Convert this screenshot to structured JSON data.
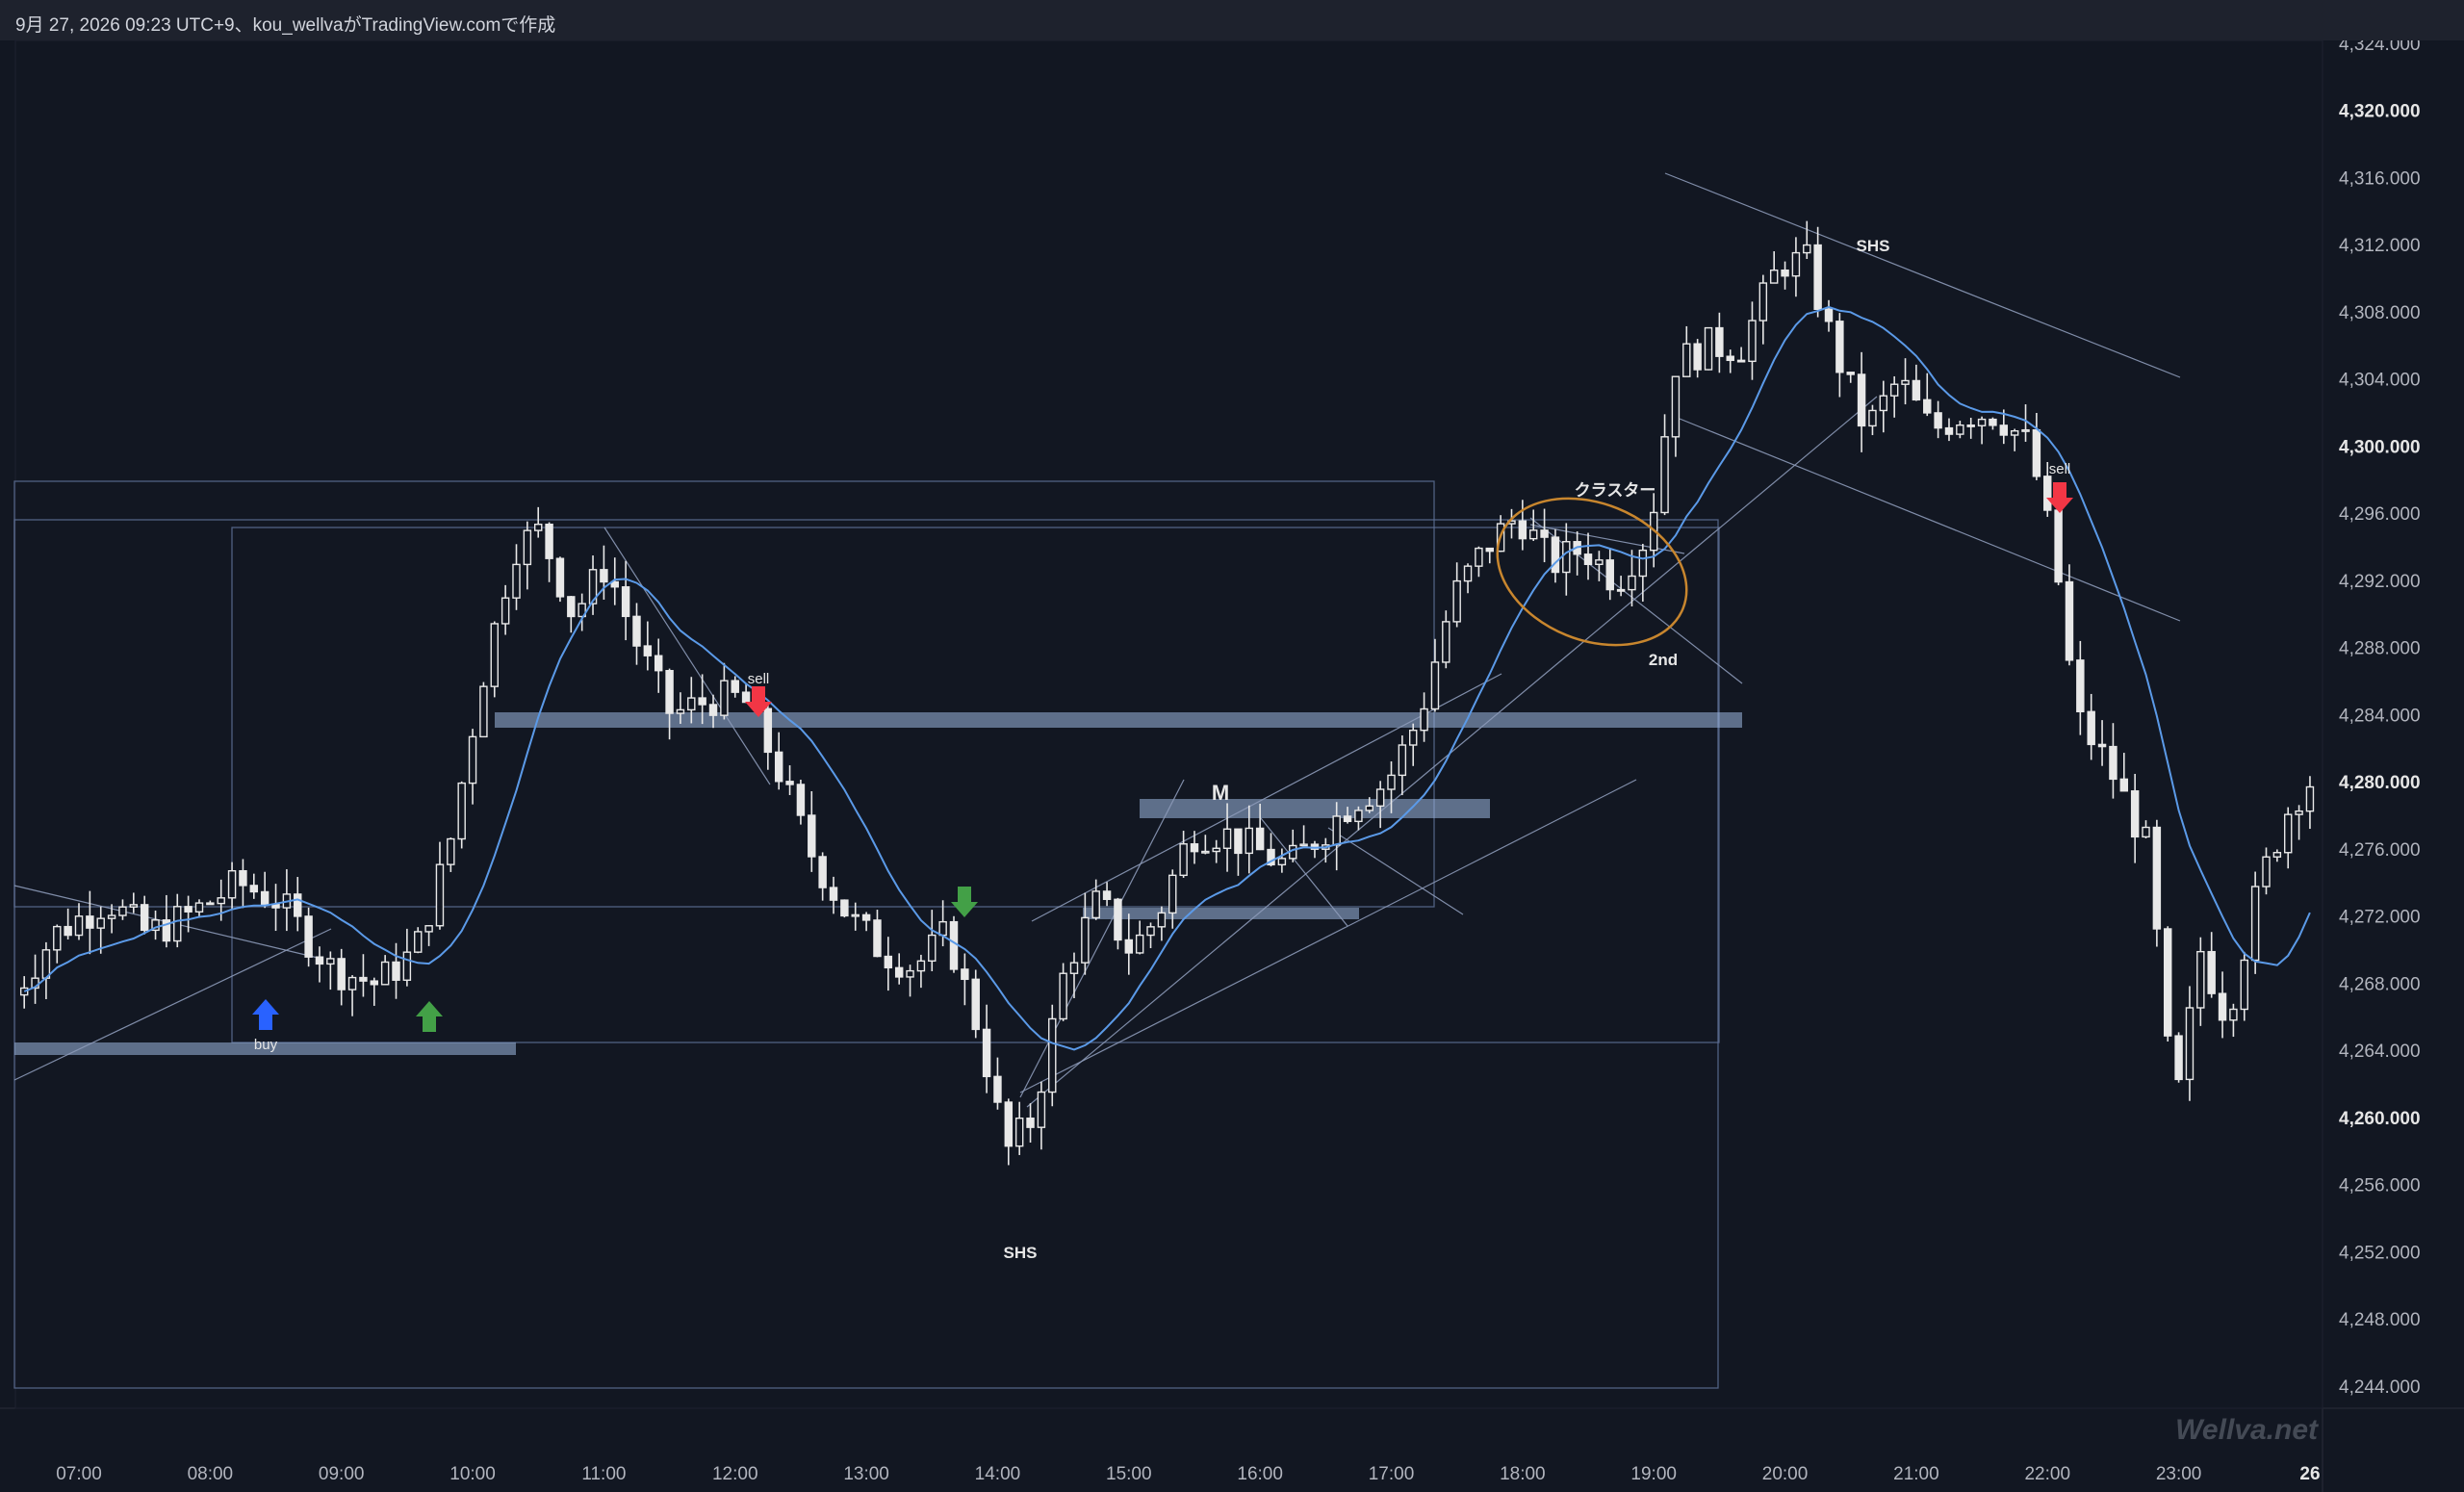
{
  "header": {
    "caption": "9月 27, 2026 09:23 UTC+9、kou_wellvaがTradingView.comで作成"
  },
  "watermark": "Wellva.net",
  "colors": {
    "background": "#121722",
    "candle_up": "#e8e8e8",
    "candle_down": "#e8e8e8",
    "ma_line": "#5b9ae8",
    "zone": "#9db8e0",
    "arrow_buy": "#2962ff",
    "arrow_up_green": "#43a047",
    "arrow_down_red": "#f23645",
    "cluster_ellipse": "#c8862e"
  },
  "chart_data": {
    "type": "candlestick",
    "y_axis": {
      "range": [
        4242,
        4326
      ],
      "tick_labels": [
        "4,324.000",
        "4,320.000",
        "4,316.000",
        "4,312.000",
        "4,308.000",
        "4,304.000",
        "4,300.000",
        "4,296.000",
        "4,292.000",
        "4,288.000",
        "4,284.000",
        "4,280.000",
        "4,276.000",
        "4,272.000",
        "4,268.000",
        "4,264.000",
        "4,260.000",
        "4,256.000",
        "4,252.000",
        "4,248.000",
        "4,244.000"
      ],
      "bold_labels": [
        "4,320.000",
        "4,300.000",
        "4,280.000",
        "4,260.000"
      ]
    },
    "x_axis": {
      "range_hours": [
        6.5,
        24.45
      ],
      "tick_labels": [
        "07:00",
        "08:00",
        "09:00",
        "10:00",
        "11:00",
        "12:00",
        "13:00",
        "14:00",
        "15:00",
        "16:00",
        "17:00",
        "18:00",
        "19:00",
        "20:00",
        "21:00",
        "22:00",
        "23:00",
        "26"
      ],
      "bold_labels": [
        "26"
      ]
    },
    "price_anchors": [
      [
        6.55,
        4267
      ],
      [
        6.9,
        4271
      ],
      [
        7.3,
        4273
      ],
      [
        7.6,
        4271
      ],
      [
        7.9,
        4272
      ],
      [
        8.3,
        4274
      ],
      [
        8.6,
        4273
      ],
      [
        9.0,
        4269
      ],
      [
        9.35,
        4268
      ],
      [
        9.65,
        4270
      ],
      [
        9.9,
        4276
      ],
      [
        10.15,
        4286
      ],
      [
        10.4,
        4294
      ],
      [
        10.6,
        4295
      ],
      [
        10.85,
        4290
      ],
      [
        11.1,
        4293
      ],
      [
        11.35,
        4288
      ],
      [
        11.6,
        4284
      ],
      [
        11.9,
        4285
      ],
      [
        12.15,
        4285
      ],
      [
        12.4,
        4281
      ],
      [
        12.65,
        4276
      ],
      [
        12.95,
        4272
      ],
      [
        13.2,
        4270
      ],
      [
        13.45,
        4269
      ],
      [
        13.7,
        4271
      ],
      [
        13.95,
        4265
      ],
      [
        14.15,
        4258
      ],
      [
        14.35,
        4260
      ],
      [
        14.6,
        4269
      ],
      [
        14.85,
        4273
      ],
      [
        15.1,
        4270
      ],
      [
        15.3,
        4272
      ],
      [
        15.55,
        4277
      ],
      [
        15.8,
        4277
      ],
      [
        16.05,
        4276
      ],
      [
        16.3,
        4275
      ],
      [
        16.55,
        4277
      ],
      [
        16.8,
        4279
      ],
      [
        17.05,
        4280
      ],
      [
        17.3,
        4284
      ],
      [
        17.55,
        4291
      ],
      [
        17.8,
        4294
      ],
      [
        18.05,
        4296
      ],
      [
        18.3,
        4293
      ],
      [
        18.55,
        4294
      ],
      [
        18.8,
        4292
      ],
      [
        19.05,
        4295
      ],
      [
        19.25,
        4305
      ],
      [
        19.5,
        4306
      ],
      [
        19.75,
        4306
      ],
      [
        20.05,
        4311
      ],
      [
        20.25,
        4311
      ],
      [
        20.45,
        4306
      ],
      [
        20.7,
        4301
      ],
      [
        20.95,
        4304
      ],
      [
        21.2,
        4301
      ],
      [
        21.45,
        4302
      ],
      [
        21.7,
        4302
      ],
      [
        21.95,
        4300
      ],
      [
        22.15,
        4293
      ],
      [
        22.3,
        4284
      ],
      [
        22.55,
        4281
      ],
      [
        22.85,
        4276
      ],
      [
        23.05,
        4260
      ],
      [
        23.25,
        4270
      ],
      [
        23.45,
        4266
      ],
      [
        23.7,
        4274
      ],
      [
        23.95,
        4279
      ],
      [
        24.2,
        4281
      ],
      [
        24.4,
        4280
      ]
    ],
    "annotations": {
      "sell_1": "sell",
      "sell_2": "sell",
      "buy": "buy",
      "shs_low": "SHS",
      "shs_high": "SHS",
      "m_pattern": "M",
      "cluster": "クラスター",
      "second": "2nd"
    }
  }
}
